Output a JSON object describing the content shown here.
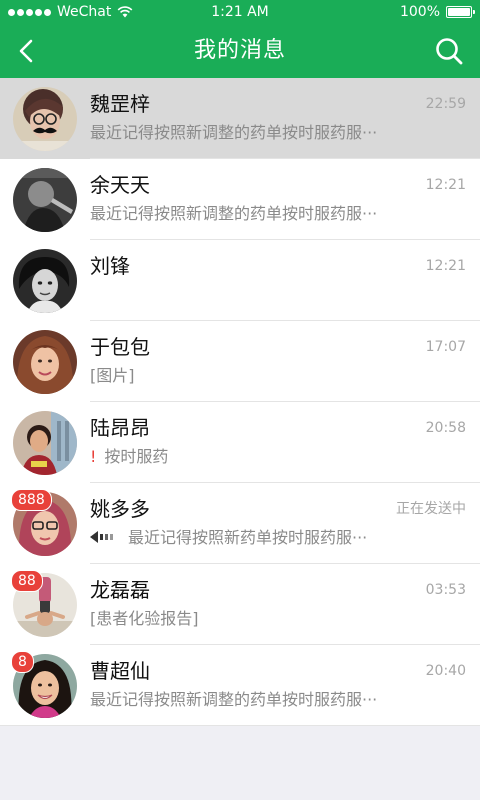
{
  "status": {
    "carrier": "WeChat",
    "time": "1:21 AM",
    "battery": "100%"
  },
  "nav": {
    "title": "我的消息",
    "back_icon": "chevron-left-icon",
    "search_icon": "search-icon"
  },
  "colors": {
    "brand": "#1aad57",
    "badge": "#e8413a",
    "highlight_row": "#d9d9d9"
  },
  "conversations": [
    {
      "name": "魏罡梓",
      "time": "22:59",
      "preview": "最近记得按照新调整的药单按时服药服···",
      "badge": "",
      "highlight": true
    },
    {
      "name": "余天天",
      "time": "12:21",
      "preview": "最近记得按照新调整的药单按时服药服···",
      "badge": ""
    },
    {
      "name": "刘锋",
      "time": "12:21",
      "preview": "",
      "badge": ""
    },
    {
      "name": "于包包",
      "time": "17:07",
      "preview": "[图片]",
      "badge": ""
    },
    {
      "name": "陆昂昂",
      "time": "20:58",
      "preview": "按时服药",
      "warn": "!",
      "badge": ""
    },
    {
      "name": "姚多多",
      "time": "正在发送中",
      "preview": "最近记得按照新药单按时服药服···",
      "badge": "888",
      "sending": true
    },
    {
      "name": "龙磊磊",
      "time": "03:53",
      "preview": "[患者化验报告]",
      "badge": "88"
    },
    {
      "name": "曹超仙",
      "time": "20:40",
      "preview": "最近记得按照新调整的药单按时服药服···",
      "badge": "8"
    }
  ]
}
